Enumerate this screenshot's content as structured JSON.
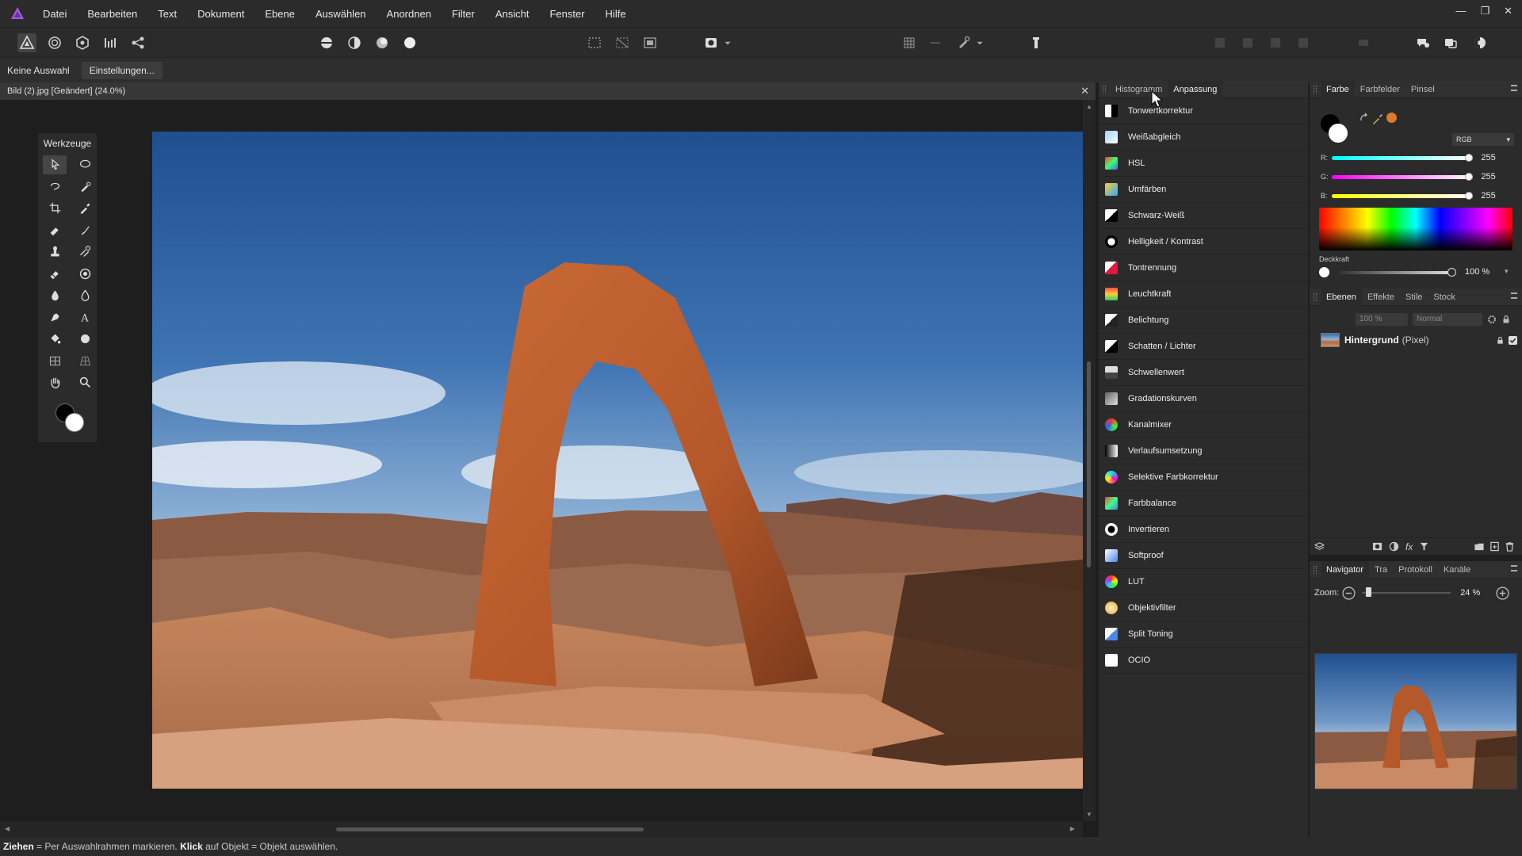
{
  "menu": [
    "Datei",
    "Bearbeiten",
    "Text",
    "Dokument",
    "Ebene",
    "Auswählen",
    "Anordnen",
    "Filter",
    "Ansicht",
    "Fenster",
    "Hilfe"
  ],
  "context": {
    "selection": "Keine Auswahl",
    "settings_button": "Einstellungen..."
  },
  "document": {
    "tab_title": "Bild (2).jpg [Geändert] (24.0%)"
  },
  "tools": {
    "title": "Werkzeuge",
    "list": [
      "move-tool",
      "lasso-tool",
      "freehand-selection-tool",
      "brush-selection-tool",
      "crop-tool",
      "color-picker-tool",
      "eraser-tool",
      "paint-brush-tool",
      "clone-stamp-tool",
      "healing-tool",
      "erase-brush-tool",
      "red-eye-tool",
      "dodge-tool",
      "burn-tool",
      "pen-tool",
      "text-tool",
      "fill-tool",
      "shape-tool",
      "mesh-warp-tool",
      "perspective-tool",
      "hand-tool",
      "zoom-tool"
    ]
  },
  "adjustments": {
    "tabs": [
      "Histogramm",
      "Anpassung"
    ],
    "active_tab": "Anpassung",
    "items": [
      {
        "label": "Tonwertkorrektur",
        "icon": "levels-icon"
      },
      {
        "label": "Weißabgleich",
        "icon": "white-balance-icon"
      },
      {
        "label": "HSL",
        "icon": "hsl-icon"
      },
      {
        "label": "Umfärben",
        "icon": "recolor-icon"
      },
      {
        "label": "Schwarz-Weiß",
        "icon": "black-white-icon"
      },
      {
        "label": "Helligkeit / Kontrast",
        "icon": "brightness-contrast-icon"
      },
      {
        "label": "Tontrennung",
        "icon": "posterize-icon"
      },
      {
        "label": "Leuchtkraft",
        "icon": "vibrance-icon"
      },
      {
        "label": "Belichtung",
        "icon": "exposure-icon"
      },
      {
        "label": "Schatten / Lichter",
        "icon": "shadows-highlights-icon"
      },
      {
        "label": "Schwellenwert",
        "icon": "threshold-icon"
      },
      {
        "label": "Gradationskurven",
        "icon": "curves-icon"
      },
      {
        "label": "Kanalmixer",
        "icon": "channel-mixer-icon"
      },
      {
        "label": "Verlaufsumsetzung",
        "icon": "gradient-map-icon"
      },
      {
        "label": "Selektive Farbkorrektur",
        "icon": "selective-color-icon"
      },
      {
        "label": "Farbbalance",
        "icon": "color-balance-icon"
      },
      {
        "label": "Invertieren",
        "icon": "invert-icon"
      },
      {
        "label": "Softproof",
        "icon": "soft-proof-icon"
      },
      {
        "label": "LUT",
        "icon": "lut-icon"
      },
      {
        "label": "Objektivfilter",
        "icon": "lens-filter-icon"
      },
      {
        "label": "Split Toning",
        "icon": "split-toning-icon"
      },
      {
        "label": "OCIO",
        "icon": "ocio-icon"
      }
    ]
  },
  "color_panel": {
    "tabs": [
      "Farbe",
      "Farbfelder",
      "Pinsel"
    ],
    "active_tab": "Farbe",
    "mode": "RGB",
    "r": {
      "label": "R:",
      "value": "255",
      "fraction": 1.0
    },
    "g": {
      "label": "G:",
      "value": "255",
      "fraction": 1.0
    },
    "b": {
      "label": "B:",
      "value": "255",
      "fraction": 1.0
    },
    "opacity_label": "Deckkraft",
    "opacity_value": "100 %",
    "swatch_color": "#e07a2a"
  },
  "layers_panel": {
    "tabs": [
      "Ebenen",
      "Effekte",
      "Stile",
      "Stock"
    ],
    "active_tab": "Ebenen",
    "opacity_field": "100 %",
    "blend_mode": "Normal",
    "layer_name": "Hintergrund",
    "layer_type": "(Pixel)"
  },
  "navigator_panel": {
    "tabs": [
      "Navigator",
      "Tra",
      "Protokoll",
      "Kanäle"
    ],
    "active_tab": "Navigator",
    "zoom_label": "Zoom:",
    "zoom_value": "24 %"
  },
  "status": {
    "drag_word": "Ziehen",
    "drag_text": " = Per Auswahlrahmen markieren. ",
    "click_word": "Klick",
    "click_text": " auf Objekt = Objekt auswählen."
  }
}
